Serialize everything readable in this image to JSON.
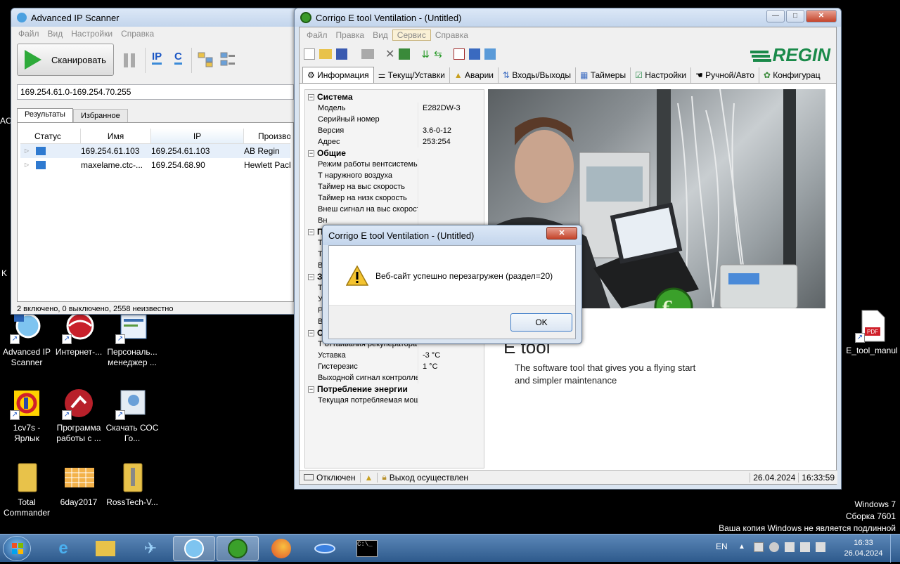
{
  "desktop": {
    "icons": [
      {
        "label": "Advanced IP Scanner"
      },
      {
        "label": "Интернет-..."
      },
      {
        "label": "Персональ... менеджер ..."
      },
      {
        "label": "1cv7s - Ярлык"
      },
      {
        "label": "Программа работы с ..."
      },
      {
        "label": "Скачать СОС Го..."
      },
      {
        "label": "Total Commander"
      },
      {
        "label": "6day2017"
      },
      {
        "label": "RossTech-V..."
      },
      {
        "label": "E_tool_manul"
      }
    ],
    "edge_letters": [
      "AC",
      "K"
    ],
    "watermark": [
      "Windows 7",
      "Сборка 7601",
      "Ваша копия Windows не является подлинной"
    ]
  },
  "ipscanner": {
    "title": "Advanced IP Scanner",
    "menu": [
      "Файл",
      "Вид",
      "Настройки",
      "Справка"
    ],
    "scan_button": "Сканировать",
    "ip_label": "IP",
    "c_label": "C",
    "range": "169.254.61.0-169.254.70.255",
    "tabs": [
      "Результаты",
      "Избранное"
    ],
    "columns": [
      "Статус",
      "Имя",
      "IP",
      "Произво"
    ],
    "rows": [
      {
        "name": "169.254.61.103",
        "ip": "169.254.61.103",
        "vendor": "AB Regin"
      },
      {
        "name": "maxelame.ctc-...",
        "ip": "169.254.68.90",
        "vendor": "Hewlett Pack"
      }
    ],
    "status": "2 включено, 0 выключено, 2558 неизвестно"
  },
  "corrigo": {
    "title": "Corrigo E tool Ventilation - (Untitled)",
    "menu": [
      "Файл",
      "Правка",
      "Вид",
      "Сервис",
      "Справка"
    ],
    "brand": "REGIN",
    "tabs": [
      "Информация",
      "Текущ/Уставки",
      "Аварии",
      "Входы/Выходы",
      "Таймеры",
      "Настройки",
      "Ручной/Авто",
      "Конфигурац"
    ],
    "tree": {
      "system": {
        "title": "Система",
        "rows": [
          {
            "k": "Модель",
            "v": "E282DW-3"
          },
          {
            "k": "Серийный номер",
            "v": ""
          },
          {
            "k": "Версия",
            "v": "3.6-0-12"
          },
          {
            "k": "Адрес",
            "v": "253:254"
          }
        ]
      },
      "general": {
        "title": "Общие",
        "rows": [
          {
            "k": "Режим работы вентсистемы",
            "v": ""
          },
          {
            "k": "Т наружного воздуха",
            "v": ""
          },
          {
            "k": "Таймер на выс скорость",
            "v": ""
          },
          {
            "k": "Таймер на низк скорость",
            "v": ""
          },
          {
            "k": "Внеш сигнал на выс скорость",
            "v": ""
          },
          {
            "k": "Вн",
            "v": ""
          }
        ]
      },
      "hidden_head_a": "П",
      "hidden_rows_a": [
        "Т",
        "Т",
        "В"
      ],
      "hidden_head_b": "З",
      "hidden_rows_b": [
        "Т",
        "У",
        "Р",
        "В"
      ],
      "hidden_head_c": "О",
      "recuperator": {
        "rows": [
          {
            "k": "Т оттаивания рекуператора",
            "v": ""
          },
          {
            "k": "Уставка",
            "v": "-3 °C"
          },
          {
            "k": "Гистерезис",
            "v": "1 °C"
          },
          {
            "k": "Выходной сигнал контроллера",
            "v": ""
          }
        ]
      },
      "energy": {
        "title": "Потребление энергии",
        "rows": [
          {
            "k": "Текущая потребляемая мощ...",
            "v": ""
          }
        ]
      }
    },
    "promo": {
      "big": "E tool",
      "line1": "The software tool that gives you a flying start",
      "line2": "and simpler maintenance"
    },
    "status": {
      "conn": "Отключен",
      "login": "Выход осуществлен",
      "date": "26.04.2024",
      "time": "16:33:59"
    }
  },
  "dialog": {
    "title": "Corrigo E tool Ventilation - (Untitled)",
    "message": "Веб-сайт успешно перезагружен (раздел=20)",
    "ok": "OK"
  },
  "taskbar": {
    "lang": "EN",
    "time": "16:33",
    "date": "26.04.2024"
  }
}
